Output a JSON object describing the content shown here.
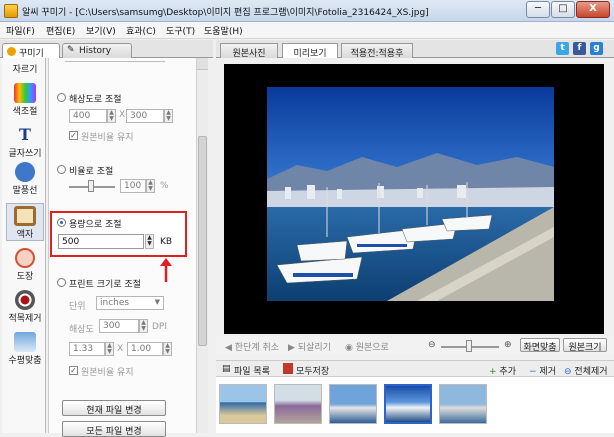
{
  "window": {
    "title": "알씨 꾸미기 - [C:\\Users\\samsumg\\Desktop\\이미지 편집 프로그램\\이미지\\Fotolia_2316424_XS.jpg]",
    "controls": {
      "minimize": "─",
      "maximize": "□",
      "close": "X"
    }
  },
  "menu": [
    "파일(F)",
    "편집(E)",
    "보기(V)",
    "효과(C)",
    "도구(T)",
    "도움말(H)"
  ],
  "left_tabs": {
    "decorate": "꾸미기",
    "history": "History"
  },
  "tools": [
    {
      "label": "자르기",
      "icon": "crop-icon"
    },
    {
      "label": "색조절",
      "icon": "color-adjust-icon"
    },
    {
      "label": "글자쓰기",
      "icon": "text-icon"
    },
    {
      "label": "말풍선",
      "icon": "speech-bubble-icon"
    },
    {
      "label": "액자",
      "icon": "frame-icon"
    },
    {
      "label": "도장",
      "icon": "stamp-icon"
    },
    {
      "label": "적목제거",
      "icon": "red-eye-icon"
    },
    {
      "label": "수평맞춤",
      "icon": "level-icon"
    }
  ],
  "panel": {
    "resolution": {
      "label": "해상도로 조절",
      "width": "400",
      "x": "X",
      "height": "300",
      "keep_ratio": "원본비율 유지"
    },
    "ratio": {
      "label": "비율로 조절",
      "value": "100",
      "unit": "%"
    },
    "capacity": {
      "label": "용량으로 조절",
      "value": "500",
      "unit": "KB"
    },
    "print": {
      "label": "프린트 크기로 조절",
      "unit_label": "단위",
      "unit_value": "inches",
      "dpi_label": "해상도",
      "dpi_value": "300",
      "dpi_unit": "DPI",
      "width": "1.33",
      "x": "X",
      "height": "1.00",
      "keep_ratio": "원본비율 유지"
    },
    "buttons": {
      "change_current": "현재 파일 변경",
      "change_all": "모든 파일 변경"
    }
  },
  "right_tabs": {
    "original": "원본사진",
    "preview": "미리보기",
    "applied": "적용전:적용후"
  },
  "social": {
    "twitter": "t",
    "facebook": "f",
    "google": "g"
  },
  "view_bar": {
    "undo": "한단계 취소",
    "redo": "되살리기",
    "original": "원본으로",
    "fit": "화면맞춤",
    "original_size": "원본크기"
  },
  "files_bar": {
    "list": "파일 목록",
    "save_all": "모두저장",
    "add": "추가",
    "remove": "제거",
    "remove_all": "전체제거"
  },
  "colors": {
    "highlight": "#e02020",
    "accent": "#2c62c9"
  }
}
